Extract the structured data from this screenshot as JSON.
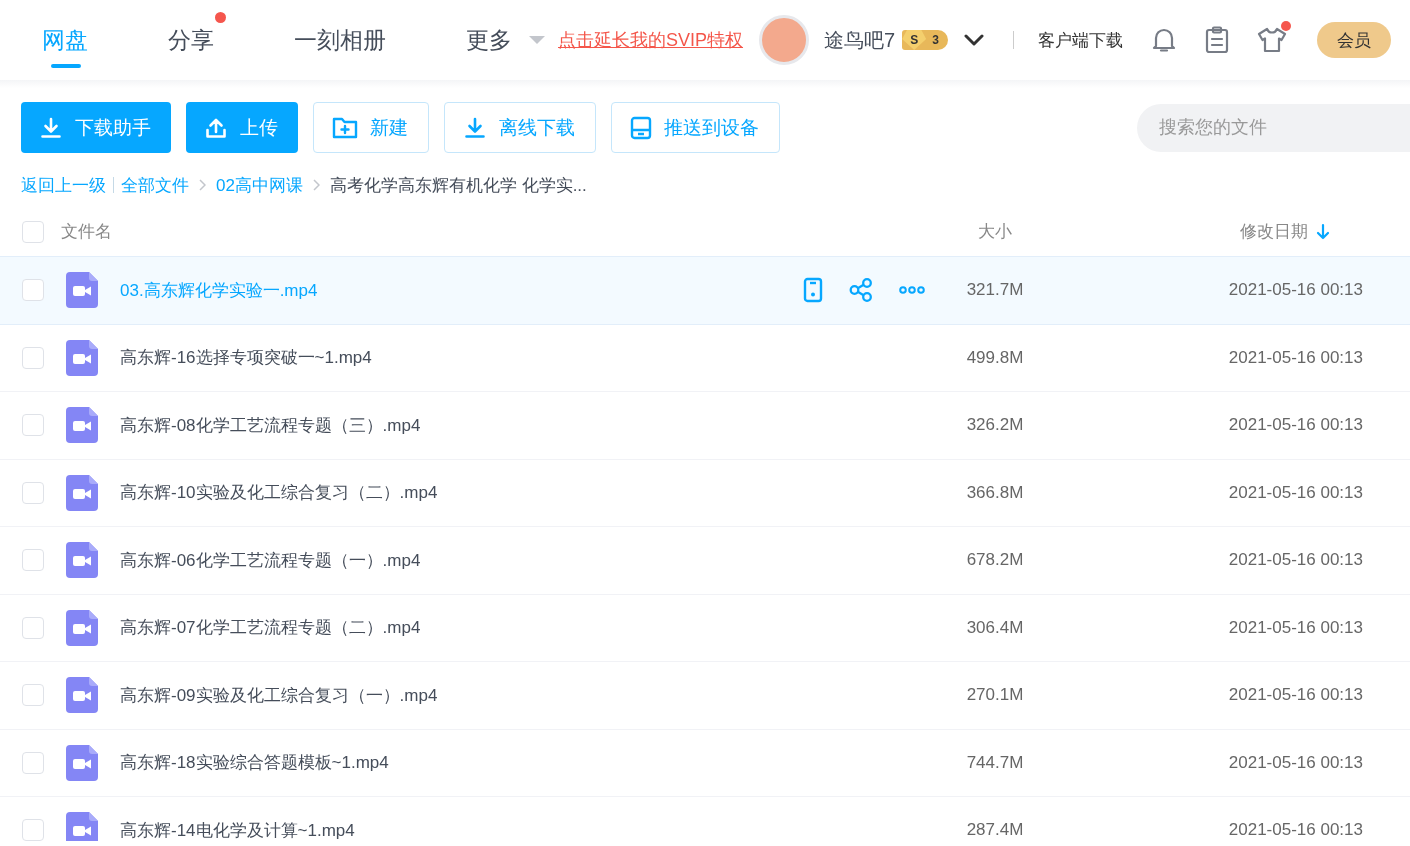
{
  "header": {
    "tabs": [
      {
        "label": "网盘",
        "selected": true,
        "dot": false,
        "dropdown": false
      },
      {
        "label": "分享",
        "selected": false,
        "dot": true,
        "dropdown": false
      },
      {
        "label": "一刻相册",
        "selected": false,
        "dot": false,
        "dropdown": false
      },
      {
        "label": "更多",
        "selected": false,
        "dot": false,
        "dropdown": true
      }
    ],
    "promo_link": "点击延长我的SVIP特权",
    "user": {
      "name": "途鸟吧7",
      "badge_letter": "S",
      "badge_number": "3"
    },
    "client_download": "客户端下载",
    "icons": [
      {
        "kind": "bell",
        "dot": false
      },
      {
        "kind": "clipboard",
        "dot": false
      },
      {
        "kind": "shirt",
        "dot": true
      }
    ],
    "member_button": "会员"
  },
  "toolbar": {
    "buttons": [
      {
        "label": "下载助手",
        "kind": "primary"
      },
      {
        "label": "上传",
        "kind": "primary"
      },
      {
        "label": "新建",
        "kind": "outline"
      },
      {
        "label": "离线下载",
        "kind": "outline"
      },
      {
        "label": "推送到设备",
        "kind": "outline"
      }
    ],
    "search": {
      "placeholder": "搜索您的文件"
    }
  },
  "breadcrumb": {
    "back": "返回上一级",
    "items": [
      {
        "label": "全部文件",
        "current": false
      },
      {
        "label": "02高中网课",
        "current": false
      },
      {
        "label": "高考化学高东辉有机化学 化学实...",
        "current": true
      }
    ]
  },
  "table": {
    "select_all_checked": false,
    "columns": [
      {
        "label": "文件名",
        "sorted": false
      },
      {
        "label": "大小",
        "sorted": false
      },
      {
        "label": "修改日期",
        "sorted": true
      }
    ],
    "rows": [
      {
        "name": "03.高东辉化学实验一.mp4",
        "size": "321.7M",
        "date": "2021-05-16 00:13",
        "checked": false,
        "highlighted": true
      },
      {
        "name": "高东辉-16选择专项突破一~1.mp4",
        "size": "499.8M",
        "date": "2021-05-16 00:13",
        "checked": false,
        "highlighted": false
      },
      {
        "name": "高东辉-08化学工艺流程专题（三）.mp4",
        "size": "326.2M",
        "date": "2021-05-16 00:13",
        "checked": false,
        "highlighted": false
      },
      {
        "name": "高东辉-10实验及化工综合复习（二）.mp4",
        "size": "366.8M",
        "date": "2021-05-16 00:13",
        "checked": false,
        "highlighted": false
      },
      {
        "name": "高东辉-06化学工艺流程专题（一）.mp4",
        "size": "678.2M",
        "date": "2021-05-16 00:13",
        "checked": false,
        "highlighted": false
      },
      {
        "name": "高东辉-07化学工艺流程专题（二）.mp4",
        "size": "306.4M",
        "date": "2021-05-16 00:13",
        "checked": false,
        "highlighted": false
      },
      {
        "name": "高东辉-09实验及化工综合复习（一）.mp4",
        "size": "270.1M",
        "date": "2021-05-16 00:13",
        "checked": false,
        "highlighted": false
      },
      {
        "name": "高东辉-18实验综合答题模板~1.mp4",
        "size": "744.7M",
        "date": "2021-05-16 00:13",
        "checked": false,
        "highlighted": false
      },
      {
        "name": "高东辉-14电化学及计算~1.mp4",
        "size": "287.4M",
        "date": "2021-05-16 00:13",
        "checked": false,
        "highlighted": false
      }
    ]
  }
}
